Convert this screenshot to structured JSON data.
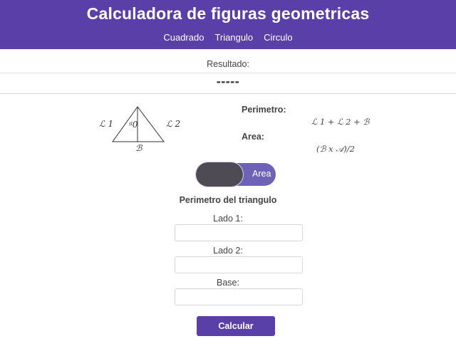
{
  "header": {
    "title": "Calculadora de figuras geometricas",
    "nav": [
      "Cuadrado",
      "Triangulo",
      "Circulo"
    ]
  },
  "result": {
    "label": "Resultado:",
    "value": "-----"
  },
  "diagram": {
    "side1": "ℒ 1",
    "side2": "ℒ 2",
    "height": "ᵍ0",
    "base": "ℬ"
  },
  "formulas": {
    "perimeter_label": "Perimetro:",
    "perimeter_formula": "ℒ 1 + ℒ 2 + ℬ",
    "area_label": "Area:",
    "area_formula": "(ℬ x 𝒜)/2"
  },
  "toggle": {
    "label": "Area",
    "state": "perimetro"
  },
  "form": {
    "title": "Perimetro del triangulo",
    "fields": [
      {
        "label": "Lado 1:",
        "value": "",
        "placeholder": ""
      },
      {
        "label": "Lado 2:",
        "value": "",
        "placeholder": ""
      },
      {
        "label": "Base:",
        "value": "",
        "placeholder": ""
      }
    ],
    "submit_label": "Calcular"
  },
  "colors": {
    "primary": "#5a3fa8",
    "toggle_track": "#6c63b8",
    "toggle_knob": "#4f4b55"
  }
}
